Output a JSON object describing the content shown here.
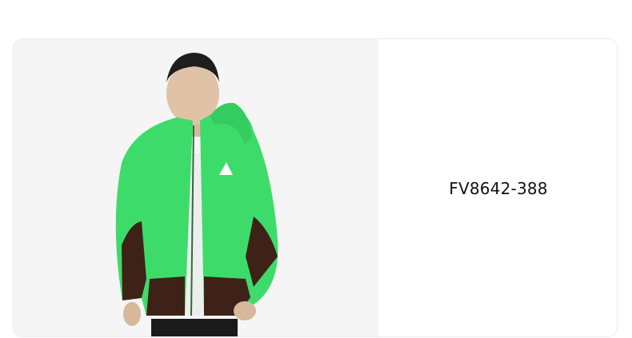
{
  "product": {
    "sku": "FV8642-388",
    "image_icon": "product-photo-icon",
    "colors": {
      "jacket_green": "#3ddc6a",
      "jacket_brown": "#3e2218",
      "background": "#f5f5f5"
    }
  }
}
